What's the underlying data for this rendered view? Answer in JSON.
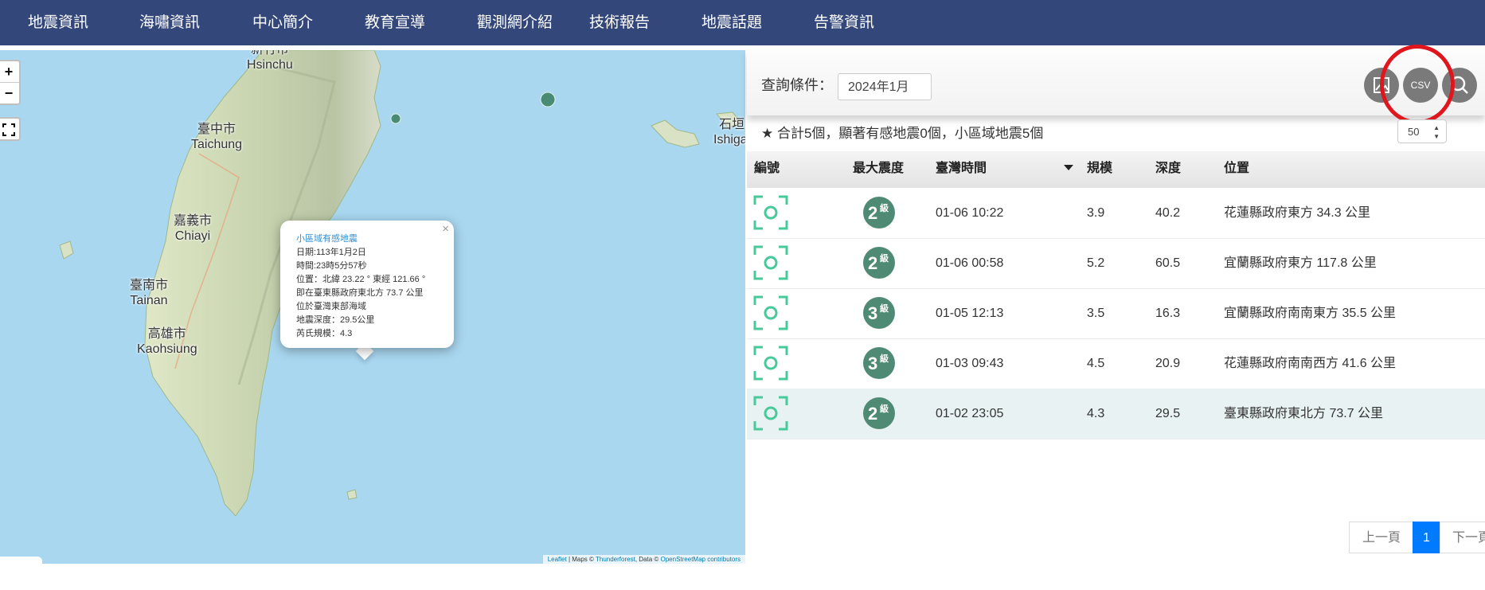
{
  "nav": [
    "地震資訊",
    "海嘯資訊",
    "中心簡介",
    "教育宣導",
    "觀測網介紹",
    "技術報告",
    "地震話題",
    "告警資訊"
  ],
  "map": {
    "zoom_in": "+",
    "zoom_out": "−",
    "cities": [
      {
        "zh": "新竹市",
        "en": "Hsinchu"
      },
      {
        "zh": "臺中市",
        "en": "Taichung"
      },
      {
        "zh": "嘉義市",
        "en": "Chiayi"
      },
      {
        "zh": "臺南市",
        "en": "Tainan"
      },
      {
        "zh": "高雄市",
        "en": "Kaohsiung"
      },
      {
        "zh": "石垣",
        "en": "Ishigal"
      }
    ],
    "popup": {
      "title": "小區域有感地震",
      "lines": [
        "日期:113年1月2日",
        "時間:23時5分57秒",
        "位置：北緯 23.22 ° 東經 121.66 °",
        "即在臺東縣政府東北方 73.7 公里",
        "位於臺灣東部海域",
        "地震深度：29.5公里",
        "芮氏規模：4.3"
      ],
      "close": "×"
    },
    "attribution": {
      "leaflet": "Leaflet",
      "sep1": " | Maps © ",
      "thunderforest": "Thunderforest",
      "sep2": ", Data © ",
      "osm": "OpenStreetMap contributors"
    },
    "marker_color": "#4a8b74"
  },
  "panel": {
    "query_label": "查詢條件：",
    "query_value": "2024年1月",
    "csv_label": "CSV",
    "summary": "合計5個，顯著有感地震0個，小區域地震5個",
    "per_page": "50",
    "headers": {
      "id": "編號",
      "intensity": "最大震度",
      "time": "臺灣時間",
      "mag": "規模",
      "depth": "深度",
      "location": "位置"
    },
    "intensity_unit": "級",
    "rows": [
      {
        "intensity": "2",
        "time": "01-06 10:22",
        "mag": "3.9",
        "depth": "40.2",
        "location": "花蓮縣政府東方 34.3 公里"
      },
      {
        "intensity": "2",
        "time": "01-06 00:58",
        "mag": "5.2",
        "depth": "60.5",
        "location": "宜蘭縣政府東方 117.8 公里"
      },
      {
        "intensity": "3",
        "time": "01-05 12:13",
        "mag": "3.5",
        "depth": "16.3",
        "location": "宜蘭縣政府南南東方 35.5 公里"
      },
      {
        "intensity": "3",
        "time": "01-03 09:43",
        "mag": "4.5",
        "depth": "20.9",
        "location": "花蓮縣政府南南西方 41.6 公里"
      },
      {
        "intensity": "2",
        "time": "01-02 23:05",
        "mag": "4.3",
        "depth": "29.5",
        "location": "臺東縣政府東北方 73.7 公里"
      }
    ],
    "pager": {
      "prev": "上一頁",
      "current": "1",
      "next": "下一頁"
    },
    "accent": "#007bff",
    "badge_color": "#4f8a74",
    "focus_color": "#47c99a"
  }
}
